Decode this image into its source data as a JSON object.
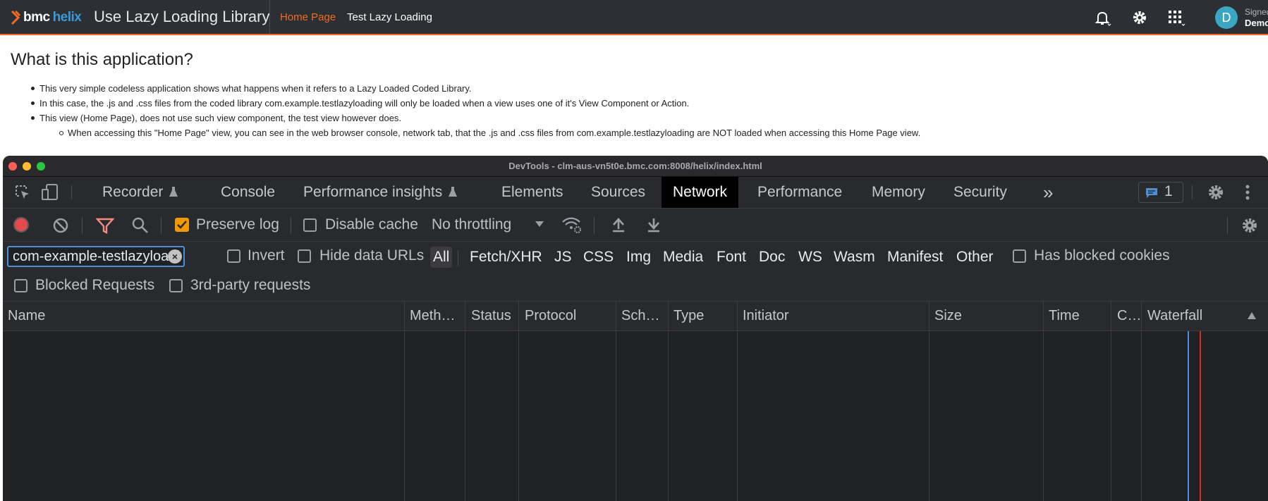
{
  "header": {
    "brand_bmc": "bmc",
    "brand_helix": "helix",
    "app_title": "Use Lazy Loading Library",
    "nav": [
      "Home Page",
      "Test Lazy Loading"
    ],
    "user_status": "Signed",
    "user_name": "Demo",
    "avatar_initial": "D"
  },
  "content": {
    "heading": "What is this application?",
    "bullets": [
      "This very simple codeless application shows what happens when it refers to a Lazy Loaded Coded Library.",
      "In this case, the .js and .css files from the coded library com.example.testlazyloading will only be loaded when a view uses one of it's View Component or Action.",
      "This view (Home Page), does not use such view component, the test view however does."
    ],
    "sub_bullet": "When accessing this \"Home Page\" view, you can see in the web browser console, network tab, that the .js and .css files from com.example.testlazyloading are NOT loaded when accessing this Home Page view."
  },
  "devtools": {
    "window_title": "DevTools - clm-aus-vn5t0e.bmc.com:8008/helix/index.html",
    "tabs": [
      "Recorder",
      "Console",
      "Performance insights",
      "Elements",
      "Sources",
      "Network",
      "Performance",
      "Memory",
      "Security"
    ],
    "active_tab": "Network",
    "message_count": "1",
    "toolbar": {
      "preserve_log": "Preserve log",
      "disable_cache": "Disable cache",
      "throttling": "No throttling"
    },
    "filter": {
      "value": "com-example-testlazyloadi",
      "invert": "Invert",
      "hide_data_urls": "Hide data URLs",
      "types": [
        "All",
        "Fetch/XHR",
        "JS",
        "CSS",
        "Img",
        "Media",
        "Font",
        "Doc",
        "WS",
        "Wasm",
        "Manifest",
        "Other"
      ],
      "has_blocked_cookies": "Has blocked cookies",
      "blocked_requests": "Blocked Requests",
      "third_party": "3rd-party requests"
    },
    "columns": [
      "Name",
      "Meth…",
      "Status",
      "Protocol",
      "Sch…",
      "Type",
      "Initiator",
      "Size",
      "Time",
      "C…",
      "Waterfall"
    ]
  },
  "colors": {
    "accent_orange": "#f26b21",
    "devtools_bg": "#202124",
    "focus_blue": "#4d8fd6",
    "record_red": "#e5484d",
    "checkbox_orange": "#f29900"
  }
}
